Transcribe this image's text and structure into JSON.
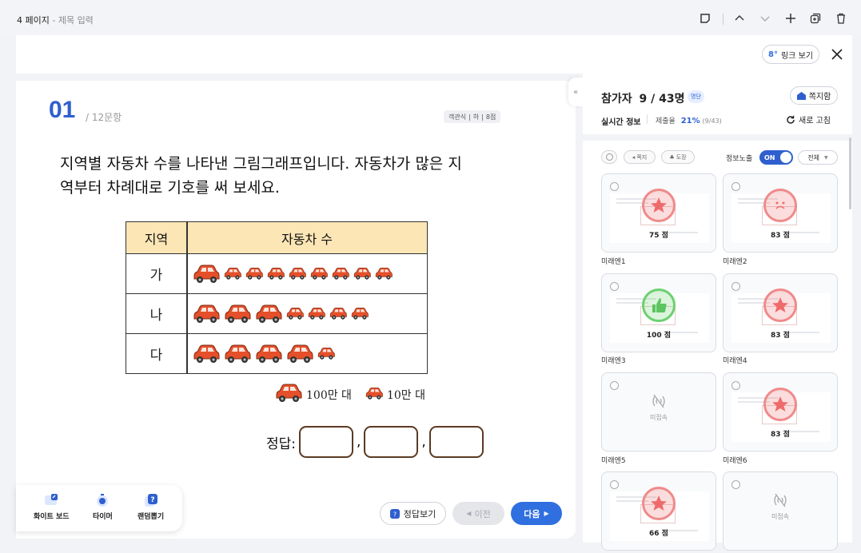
{
  "topbar": {
    "page_label": "4 페이지",
    "title_placeholder": "제목 입력"
  },
  "header": {
    "link_button": "링크 보기"
  },
  "question": {
    "number": "01",
    "count": "/ 12문항",
    "meta": {
      "type": "객관식",
      "level": "하",
      "points": "8점"
    },
    "text_line1": "지역별 자동차 수를 나타낸 그림그래프입니다. 자동차가 많은 지",
    "text_line2": "역부터 차례대로 기호를 써 보세요.",
    "table": {
      "headers": [
        "지역",
        "자동차 수"
      ],
      "rows": [
        {
          "label": "가",
          "big": 1,
          "small": 8
        },
        {
          "label": "나",
          "big": 3,
          "small": 4
        },
        {
          "label": "다",
          "big": 4,
          "small": 1
        }
      ]
    },
    "legend": {
      "big": "100만 대",
      "small": "10만 대"
    },
    "answer_label": "정답:",
    "answer_sep": ","
  },
  "tools": [
    {
      "label": "화이트 보드"
    },
    {
      "label": "타이머"
    },
    {
      "label": "랜덤뽑기"
    }
  ],
  "nav": {
    "answer_view": "정답보기",
    "prev": "이전",
    "next": "다음"
  },
  "panel": {
    "participants_label": "참가자",
    "participants_count": "9 / 43명",
    "badge": "명단",
    "note_button": "쪽지함",
    "realtime_label": "실시간 정보",
    "submission_label": "제출율",
    "submission_rate": "21%",
    "submission_fraction": "(9/43)",
    "refresh": "새로 고침",
    "chips": [
      "쪽지",
      "도장"
    ],
    "info_label": "정보노출",
    "toggle": "ON",
    "filter": "전체",
    "offline_label": "미접속",
    "students": [
      {
        "name": "미래엔1",
        "score": "75 점",
        "stamp": "star",
        "online": true
      },
      {
        "name": "미래엔2",
        "score": "83 점",
        "stamp": "woops",
        "online": true
      },
      {
        "name": "미래엔3",
        "score": "100 점",
        "stamp": "good",
        "online": true
      },
      {
        "name": "미래엔4",
        "score": "83 점",
        "stamp": "star",
        "online": true
      },
      {
        "name": "미래엔5",
        "score": "",
        "stamp": "",
        "online": false
      },
      {
        "name": "미래엔6",
        "score": "83 점",
        "stamp": "star",
        "online": true
      },
      {
        "name": "",
        "score": "66 점",
        "stamp": "star",
        "online": true
      },
      {
        "name": "",
        "score": "",
        "stamp": "",
        "online": false
      }
    ]
  },
  "colors": {
    "accent": "#2f6fe0",
    "qnum": "#2f5fcf",
    "car": "#e5502a",
    "table_header": "#fde6b5",
    "answer_box": "#5b3a22"
  }
}
